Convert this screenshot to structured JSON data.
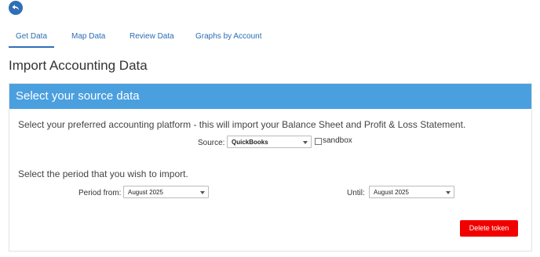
{
  "tabs": [
    {
      "label": "Get Data"
    },
    {
      "label": "Map Data"
    },
    {
      "label": "Review Data"
    },
    {
      "label": "Graphs by Account"
    }
  ],
  "page_title": "Import Accounting Data",
  "panel": {
    "header": "Select your source data",
    "platform_instruction": "Select your preferred accounting platform - this will import your Balance Sheet and Profit & Loss Statement.",
    "source_label": "Source:",
    "source_value": "QuickBooks",
    "sandbox_label": "sandbox",
    "sandbox_checked": false,
    "period_instruction": "Select the period that you wish to import.",
    "period_from_label": "Period from:",
    "period_from_value": "August 2025",
    "until_label": "Until:",
    "until_value": "August 2025",
    "delete_label": "Delete token"
  },
  "colors": {
    "accent": "#4a9fdf",
    "link": "#2a6db0",
    "danger": "#f20000"
  },
  "icons": {
    "back": "back-arrow-icon",
    "dropdown": "chevron-down-icon"
  }
}
